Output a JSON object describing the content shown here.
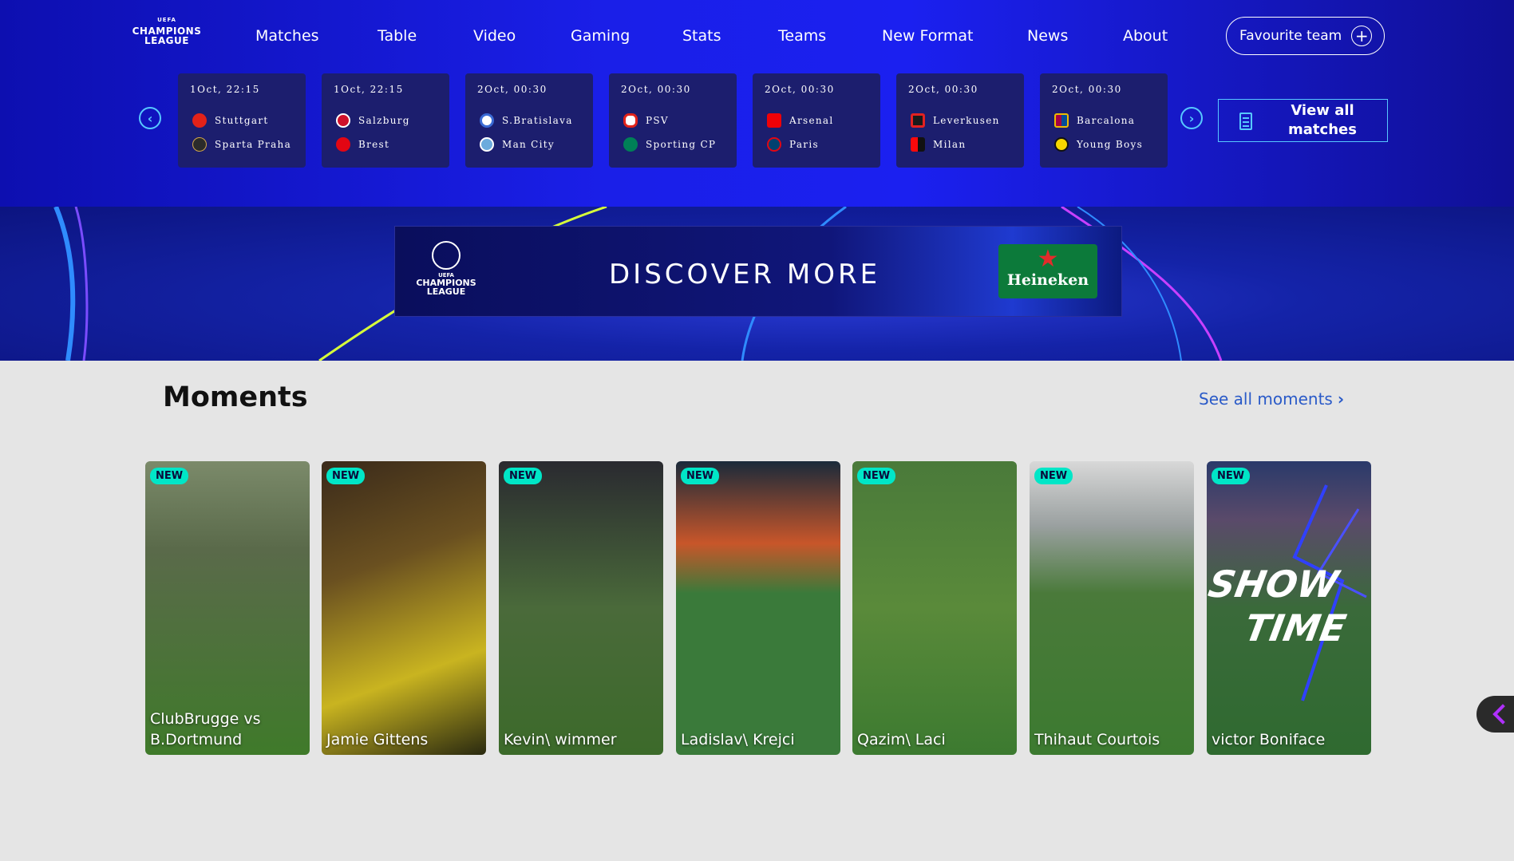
{
  "header": {
    "logo": {
      "uefa": "UEFA",
      "line1": "CHAMPIONS",
      "line2": "LEAGUE"
    },
    "nav": [
      {
        "label": "Matches"
      },
      {
        "label": "Table"
      },
      {
        "label": "Video"
      },
      {
        "label": "Gaming"
      },
      {
        "label": "Stats"
      },
      {
        "label": "Teams"
      },
      {
        "label": "New Format"
      },
      {
        "label": "News"
      },
      {
        "label": "About"
      }
    ],
    "favourite_label": "Favourite team"
  },
  "matches": [
    {
      "date": "1Oct, 22:15",
      "home": "Stuttgart",
      "away": "Sparta Praha",
      "home_color": "#e32219",
      "away_color": "#2b2b2b"
    },
    {
      "date": "1Oct, 22:15",
      "home": "Salzburg",
      "away": "Brest",
      "home_color": "#d0112b",
      "away_color": "#e30613"
    },
    {
      "date": "2Oct, 00:30",
      "home": "S.Bratislava",
      "away": "Man City",
      "home_color": "#3a6ad4",
      "away_color": "#6cabdd"
    },
    {
      "date": "2Oct, 00:30",
      "home": "PSV",
      "away": "Sporting CP",
      "home_color": "#e2231a",
      "away_color": "#008057"
    },
    {
      "date": "2Oct, 00:30",
      "home": "Arsenal",
      "away": "Paris",
      "home_color": "#ef0107",
      "away_color": "#004170"
    },
    {
      "date": "2Oct, 00:30",
      "home": "Leverkusen",
      "away": "Milan",
      "home_color": "#e32221",
      "away_color": "#fb090b"
    },
    {
      "date": "2Oct, 00:30",
      "home": "Barcalona",
      "away": "Young Boys",
      "home_color": "#a50044",
      "away_color": "#f6d600"
    }
  ],
  "view_all": {
    "line1": "View all",
    "line2": "matches"
  },
  "banner": {
    "ad_logo": {
      "uefa": "UEFA",
      "line1": "CHAMPIONS",
      "line2": "LEAGUE"
    },
    "headline": "DISCOVER MORE",
    "sponsor": "Heineken"
  },
  "moments": {
    "title": "Moments",
    "see_all": "See all moments",
    "badge": "NEW",
    "items": [
      {
        "label": "ClubBrugge vs B.Dortmund",
        "top": "#7b8a6a",
        "bottom": "#3f7a2a"
      },
      {
        "label": "Jamie Gittens",
        "top": "#3a2a1a",
        "bottom": "#c9b420"
      },
      {
        "label": "Kevin\\ wimmer",
        "top": "#2a2a30",
        "bottom": "#3c6a2a"
      },
      {
        "label": "Ladislav\\ Krejci",
        "top": "#1a2a3a",
        "bottom": "#3a7a3a"
      },
      {
        "label": "Qazim\\ Laci",
        "top": "#4a7a3a",
        "bottom": "#3c7a30"
      },
      {
        "label": "Thihaut Courtois",
        "top": "#d8d8d8",
        "bottom": "#3c7a30"
      },
      {
        "label": "victor Boniface",
        "top": "#2a3a6a",
        "bottom": "#2f6a30"
      }
    ]
  },
  "colors": {
    "header_blue": "#1a1fe8",
    "accent_cyan": "#57c8ff",
    "badge": "#00e6c7",
    "link_blue": "#2a5ac8"
  }
}
